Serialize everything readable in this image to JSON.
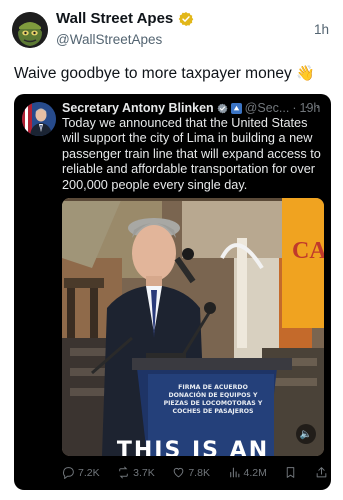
{
  "post": {
    "author_name": "Wall Street Apes",
    "author_handle": "@WallStreetApes",
    "time": "1h",
    "text": "Waive goodbye to more taxpayer money",
    "text_emoji": "👋"
  },
  "quoted": {
    "author_name": "Secretary Antony Blinken",
    "author_handle": "@Sec...",
    "time_sep": "·",
    "time": "19h",
    "more": "···",
    "text": "Today we announced that the United States will support the city of Lima in building a new passenger train line that will expand access to reliable and affordable transportation for over 200,000 people every single day.",
    "media": {
      "sign_text": "CA",
      "podium_text": "FIRMA DE ACUERDO DONACIÓN DE EQUIPOS Y PIEZAS DE LOCOMOTORAS Y COCHES DE PASAJEROS",
      "caption": "THIS IS AN"
    },
    "stats": {
      "replies": "7.2K",
      "reposts": "3.7K",
      "likes": "7.8K",
      "views": "4.2M"
    }
  },
  "colors": {
    "verified_gold": "#e2b719",
    "verified_blue": "#1d9bf0",
    "quote_bg": "#000000",
    "muted_text": "#536471"
  }
}
